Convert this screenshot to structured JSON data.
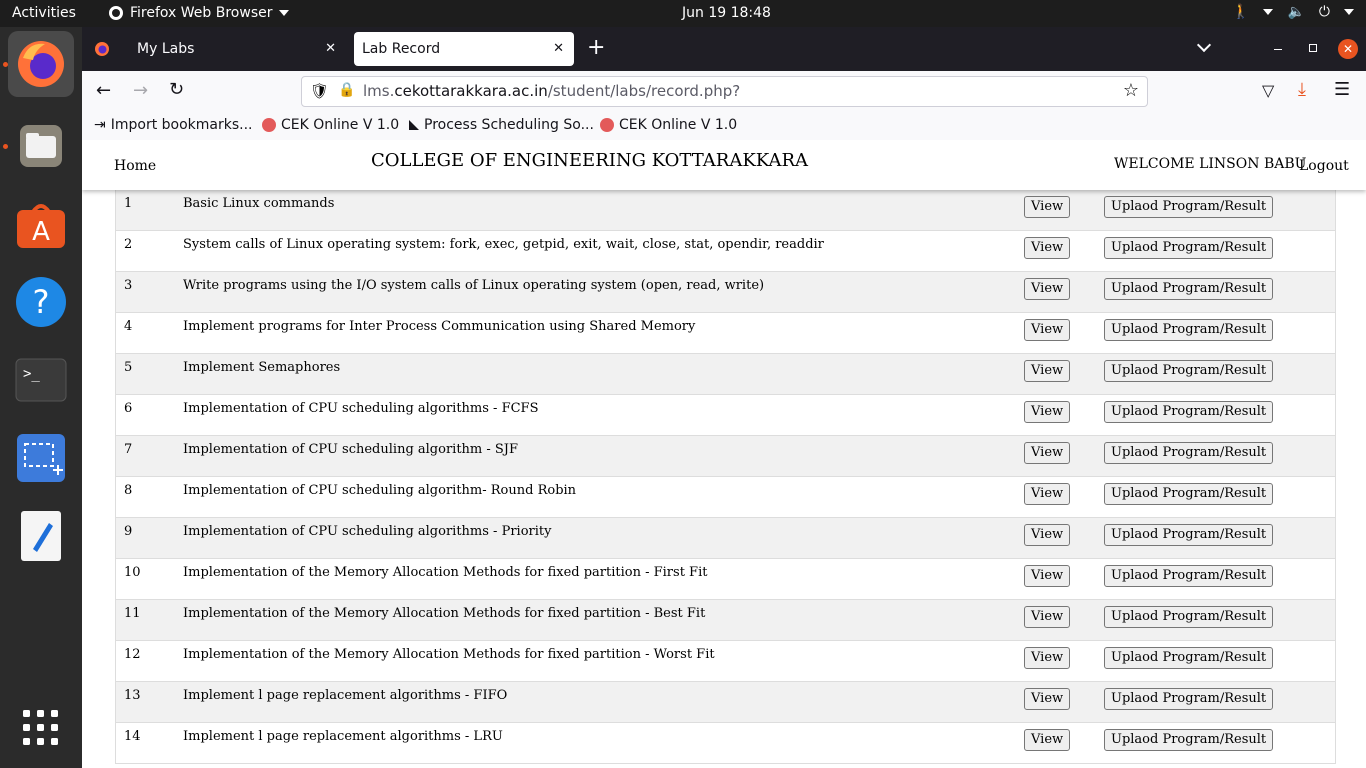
{
  "system": {
    "activities": "Activities",
    "app_name": "Firefox Web Browser",
    "clock": "Jun 19  18:48"
  },
  "browser": {
    "tabs": [
      {
        "title": "My Labs"
      },
      {
        "title": "Lab Record"
      }
    ],
    "url_prefix": "lms.",
    "url_host": "cekottarakkara.ac.in",
    "url_path": "/student/labs/record.php?",
    "bookmarks": [
      {
        "label": "Import bookmarks..."
      },
      {
        "label": "CEK Online V 1.0"
      },
      {
        "label": "Process Scheduling So..."
      },
      {
        "label": "CEK Online V 1.0"
      }
    ]
  },
  "site": {
    "home": "Home",
    "college": "COLLEGE OF ENGINEERING KOTTARAKKARA",
    "welcome": "WELCOME LINSON BABU",
    "logout": "Logout"
  },
  "labs": [
    {
      "no": "1",
      "title": "Basic Linux commands"
    },
    {
      "no": "2",
      "title": "System calls of Linux operating system: fork, exec, getpid, exit, wait, close, stat, opendir, readdir"
    },
    {
      "no": "3",
      "title": "Write programs using the I/O system calls of Linux operating system (open, read, write)"
    },
    {
      "no": "4",
      "title": "Implement programs for Inter Process Communication using Shared Memory"
    },
    {
      "no": "5",
      "title": "Implement Semaphores"
    },
    {
      "no": "6",
      "title": "Implementation of CPU scheduling algorithms - FCFS"
    },
    {
      "no": "7",
      "title": "Implementation of CPU scheduling algorithm - SJF"
    },
    {
      "no": "8",
      "title": "Implementation of CPU scheduling algorithm- Round Robin"
    },
    {
      "no": "9",
      "title": "Implementation of CPU scheduling algorithms - Priority"
    },
    {
      "no": "10",
      "title": "Implementation of the Memory Allocation Methods for fixed partition - First Fit"
    },
    {
      "no": "11",
      "title": "Implementation of the Memory Allocation Methods for fixed partition - Best Fit"
    },
    {
      "no": "12",
      "title": "Implementation of the Memory Allocation Methods for fixed partition - Worst Fit"
    },
    {
      "no": "13",
      "title": "Implement l page replacement algorithms - FIFO"
    },
    {
      "no": "14",
      "title": "Implement l page replacement algorithms - LRU"
    }
  ],
  "buttons": {
    "view": "View",
    "upload": "Uplaod Program/Result"
  }
}
